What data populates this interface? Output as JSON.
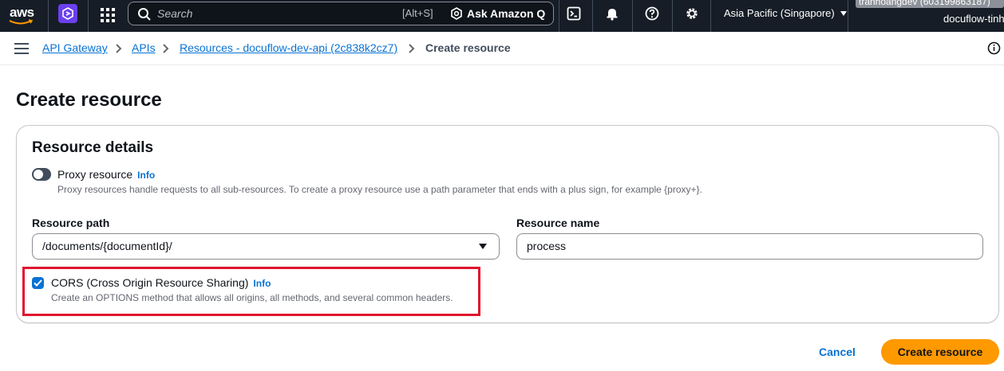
{
  "topnav": {
    "logo_text": "aws",
    "search_placeholder": "Search",
    "search_shortcut": "[Alt+S]",
    "ask_q_label": "Ask Amazon Q",
    "region_label": "Asia Pacific (Singapore)",
    "account_label": "tranhoangdev (603199863187)",
    "account_sub": "docuflow-tinh"
  },
  "breadcrumb": {
    "items": [
      "API Gateway",
      "APIs",
      "Resources - docuflow-dev-api (2c838k2cz7)"
    ],
    "current": "Create resource"
  },
  "page": {
    "title": "Create resource"
  },
  "resource_details": {
    "title": "Resource details",
    "proxy": {
      "label": "Proxy resource",
      "info": "Info",
      "description": "Proxy resources handle requests to all sub-resources. To create a proxy resource use a path parameter that ends with a plus sign, for example {proxy+}.",
      "enabled": false
    },
    "resource_path": {
      "label": "Resource path",
      "value": "/documents/{documentId}/"
    },
    "resource_name": {
      "label": "Resource name",
      "value": "process"
    },
    "cors": {
      "label": "CORS (Cross Origin Resource Sharing)",
      "info": "Info",
      "description": "Create an OPTIONS method that allows all origins, all methods, and several common headers.",
      "checked": true
    }
  },
  "actions": {
    "cancel_label": "Cancel",
    "submit_label": "Create resource"
  },
  "colors": {
    "nav_bg": "#161d26",
    "link": "#0972d3",
    "primary_button": "#ff9900",
    "highlight_border": "#e0142c"
  }
}
